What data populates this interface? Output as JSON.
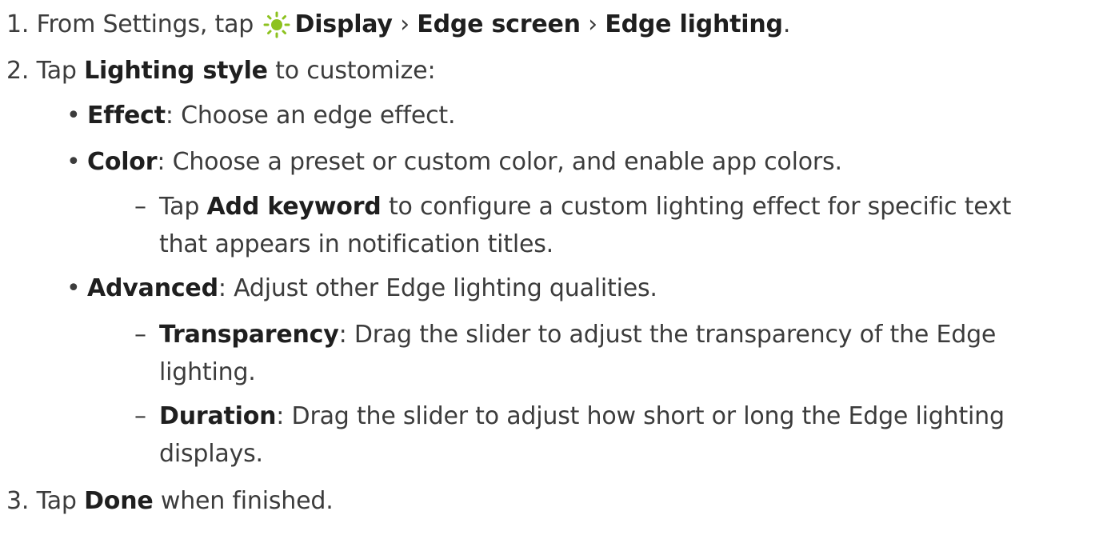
{
  "steps": [
    {
      "number": "1.",
      "prefix": "From Settings, tap",
      "icon": "display-settings-icon",
      "path": [
        "Display",
        "Edge screen",
        "Edge lighting"
      ],
      "separator": "›",
      "end": "."
    },
    {
      "number": "2.",
      "before": "Tap",
      "strong": "Lighting style",
      "after": "to customize:"
    },
    {
      "number": "3.",
      "before": "Tap",
      "strong": "Done",
      "after": "when finished."
    }
  ],
  "options": {
    "bullet": "•",
    "dash": "–",
    "effect": {
      "strong": "Effect",
      "text": ": Choose an edge effect."
    },
    "color": {
      "strong": "Color",
      "text": ": Choose a preset or custom color, and enable app colors."
    },
    "add_keyword": {
      "before": "Tap",
      "strong": "Add keyword",
      "text_line1": "to configure a custom lighting effect for specific text",
      "text_line2": "that appears in notification titles."
    },
    "advanced": {
      "strong": "Advanced",
      "text": ": Adjust other Edge lighting qualities."
    },
    "transparency": {
      "strong": "Transparency",
      "text_line1": ": Drag the slider to adjust the transparency of the Edge",
      "text_line2": "lighting."
    },
    "duration": {
      "strong": "Duration",
      "text_line1": ": Drag the slider to adjust how short or long the Edge lighting",
      "text_line2": "displays."
    }
  },
  "colors": {
    "icon_accent": "#8dc21f",
    "text": "#3c3c3c",
    "emphasis": "#1f1f1f"
  }
}
